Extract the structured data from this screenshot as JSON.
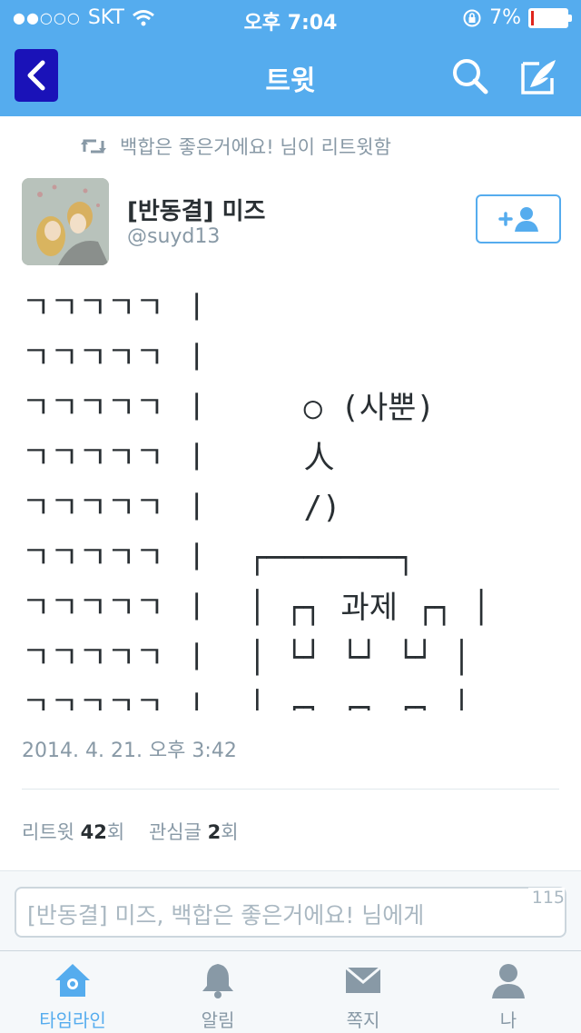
{
  "status_bar": {
    "carrier": "SKT",
    "time": "오후 7:04",
    "battery_percent": "7%",
    "battery_level": 0.07,
    "battery_color": "#e0251c"
  },
  "nav": {
    "title": "트윗",
    "back_icon": "chevron-left-icon",
    "search_icon": "search-icon",
    "compose_icon": "compose-tweet-icon"
  },
  "retweet_context": "백합은 좋은거에요! 님이 리트윗함",
  "author": {
    "name": "[반동결] 미즈",
    "handle": "@suyd13"
  },
  "follow_icon": "add-user-icon",
  "tweet_text": "ㄱㄱㄱㄱㄱ ㅣ\nㄱㄱㄱㄱㄱ ㅣ\nㄱㄱㄱㄱㄱ ㅣ     ○ (사뿐)\nㄱㄱㄱㄱㄱ ㅣ     人\nㄱㄱㄱㄱㄱ ㅣ     /)\nㄱㄱㄱㄱㄱ ㅣ  ┌───────┐\nㄱㄱㄱㄱㄱ ㅣ  │ ┌┐ 과제 ┌┐ │\nㄱㄱㄱㄱㄱ ㅣ  │ └┘ └┘ └┘ │\nㄱㄱㄱㄱㄱ ㅣ  │ ┌┐ ┌┐ ┌┐ │",
  "timestamp": "2014. 4. 21. 오후 3:42",
  "stats": {
    "retweet_label": "리트윗",
    "retweet_count": "42",
    "retweet_unit": "회",
    "favorite_label": "관심글",
    "favorite_count": "2",
    "favorite_unit": "회"
  },
  "reply": {
    "placeholder": "[반동결] 미즈, 백합은 좋은거에요! 님에게",
    "char_count": "115"
  },
  "tabs": [
    {
      "label": "타임라인",
      "icon": "home-icon",
      "active": true
    },
    {
      "label": "알림",
      "icon": "bell-icon",
      "active": false
    },
    {
      "label": "쪽지",
      "icon": "envelope-icon",
      "active": false
    },
    {
      "label": "나",
      "icon": "profile-icon",
      "active": false
    }
  ],
  "colors": {
    "brand": "#55acee",
    "back_button": "#1a12b8",
    "muted_text": "#8899a6"
  }
}
